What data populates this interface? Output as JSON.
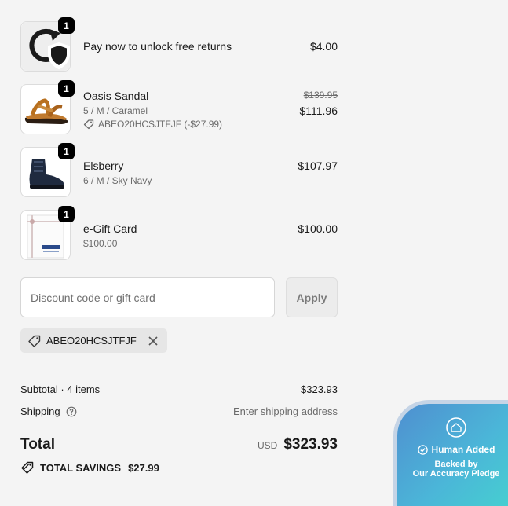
{
  "line_items": [
    {
      "name": "Pay now to unlock free returns",
      "variant": "",
      "price": "$4.00",
      "qty": "1",
      "icon": "return-shield-icon"
    },
    {
      "name": "Oasis Sandal",
      "variant": "5 / M / Caramel",
      "discount_code": "ABEO20HCSJTFJF (-$27.99)",
      "original_price": "$139.95",
      "price": "$111.96",
      "qty": "1",
      "icon": "sandal-image"
    },
    {
      "name": "Elsberry",
      "variant": "6 / M / Sky Navy",
      "price": "$107.97",
      "qty": "1",
      "icon": "boot-image"
    },
    {
      "name": "e-Gift Card",
      "variant": "$100.00",
      "price": "$100.00",
      "qty": "1",
      "icon": "gift-card-image"
    }
  ],
  "discount": {
    "placeholder": "Discount code or gift card",
    "apply_label": "Apply",
    "applied_code": "ABEO20HCSJTFJF"
  },
  "summary": {
    "subtotal_label": "Subtotal · 4 items",
    "subtotal_value": "$323.93",
    "shipping_label": "Shipping",
    "shipping_value": "Enter shipping address",
    "total_label": "Total",
    "currency": "USD",
    "total_value": "$323.93",
    "savings_label": "TOTAL SAVINGS",
    "savings_value": "$27.99"
  },
  "badge": {
    "title": "Human Added",
    "line1": "Backed by",
    "line2": "Our Accuracy Pledge"
  }
}
